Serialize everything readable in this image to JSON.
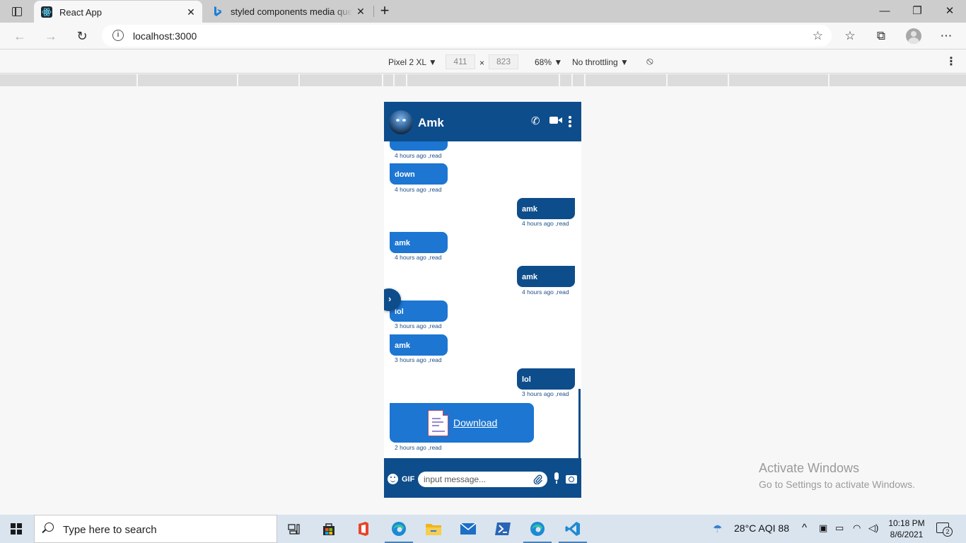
{
  "browser": {
    "tabs": [
      {
        "title": "React App",
        "active": true,
        "icon": "react-icon"
      },
      {
        "title": "styled components media queries",
        "active": false,
        "icon": "bing-icon"
      }
    ],
    "close_glyph": "✕",
    "new_tab_glyph": "+",
    "url": "localhost:3000",
    "window_controls": {
      "minimize": "—",
      "maximize": "❐",
      "close": "✕"
    }
  },
  "device_toolbar": {
    "device": "Pixel 2 XL ▼",
    "width": "411",
    "times": "×",
    "height": "823",
    "zoom": "68% ▼",
    "throttling": "No throttling ▼",
    "more": "⋮"
  },
  "chat": {
    "contact_name": "Amk",
    "toggle_glyph": "›",
    "messages": [
      {
        "side": "in",
        "text": "",
        "meta": "4 hours ago ,read"
      },
      {
        "side": "in",
        "text": "down",
        "meta": "4 hours ago ,read"
      },
      {
        "side": "out",
        "text": "amk",
        "meta": "4 hours ago ,read"
      },
      {
        "side": "in",
        "text": "amk",
        "meta": "4 hours ago ,read"
      },
      {
        "side": "out",
        "text": "amk",
        "meta": "4 hours ago ,read"
      },
      {
        "side": "in",
        "text": "lol",
        "meta": "3 hours ago ,read"
      },
      {
        "side": "in",
        "text": "amk",
        "meta": "3 hours ago ,read"
      },
      {
        "side": "out",
        "text": "lol",
        "meta": "3 hours ago ,read"
      }
    ],
    "file_message": {
      "link_text": "Download",
      "meta": "2 hours ago ,read"
    },
    "composer": {
      "gif_label": "GIF",
      "placeholder": "input message...",
      "clip_glyph": "⌀"
    },
    "colors": {
      "header": "#0e4d8b",
      "incoming": "#1c76d2",
      "outgoing": "#0e4d8b"
    }
  },
  "watermark": {
    "title": "Activate Windows",
    "subtitle": "Go to Settings to activate Windows."
  },
  "taskbar": {
    "search_placeholder": "Type here to search",
    "weather": "28°C  AQI 88",
    "chevron": "^",
    "time": "10:18 PM",
    "date": "8/6/2021",
    "notifications": "2"
  }
}
